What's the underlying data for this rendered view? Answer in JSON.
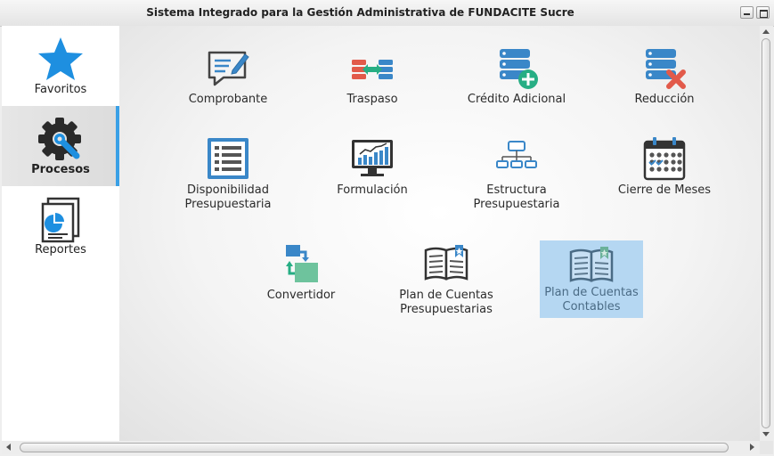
{
  "window": {
    "title": "Sistema Integrado para la Gestión Administrativa de FUNDACITE Sucre"
  },
  "sidebar": {
    "items": [
      {
        "label": "Favoritos",
        "icon": "star-icon",
        "active": false
      },
      {
        "label": "Procesos",
        "icon": "gear-wrench-icon",
        "active": true
      },
      {
        "label": "Reportes",
        "icon": "report-icon",
        "active": false
      }
    ]
  },
  "tiles": [
    {
      "label": "Comprobante",
      "icon": "voucher-icon"
    },
    {
      "label": "Traspaso",
      "icon": "transfer-icon"
    },
    {
      "label": "Crédito Adicional",
      "icon": "add-credit-icon"
    },
    {
      "label": "Reducción",
      "icon": "reduction-icon"
    },
    {
      "label": "Disponibilidad\nPresupuestaria",
      "icon": "checklist-icon"
    },
    {
      "label": "Formulación",
      "icon": "monitor-chart-icon"
    },
    {
      "label": "Estructura\nPresupuestaria",
      "icon": "org-structure-icon"
    },
    {
      "label": "Cierre de Meses",
      "icon": "calendar-icon"
    },
    {
      "label": "Convertidor",
      "icon": "converter-icon"
    },
    {
      "label": "Plan de Cuentas\nPresupuestarias",
      "icon": "book-icon"
    },
    {
      "label": "Plan de Cuentas\nContables",
      "icon": "book-icon",
      "selected": true
    }
  ],
  "colors": {
    "accent": "#3aa0e6",
    "selection": "#b5d7f2",
    "icon_blue": "#3a87c8",
    "icon_green": "#27ae84",
    "icon_red": "#e25a4a"
  }
}
